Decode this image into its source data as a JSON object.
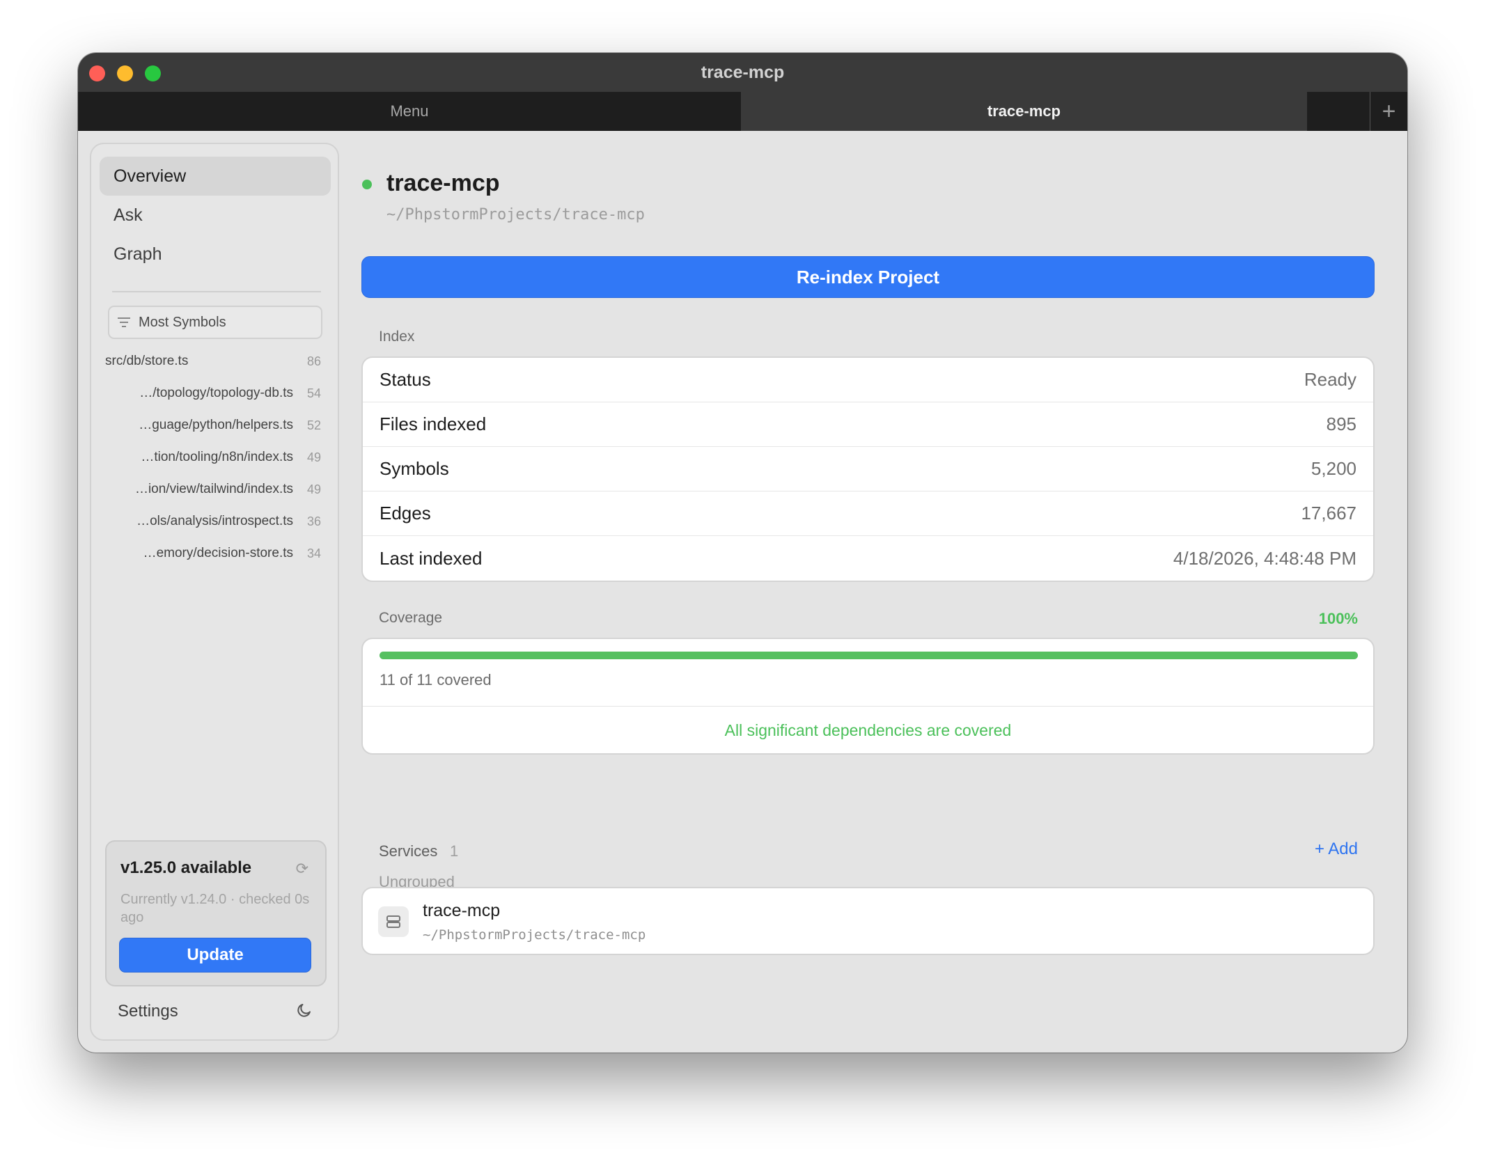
{
  "window": {
    "title": "trace-mcp"
  },
  "tabs": {
    "menu_label": "Menu",
    "active_label": "trace-mcp",
    "add_label": "+"
  },
  "sidebar": {
    "nav": [
      {
        "label": "Overview",
        "active": true
      },
      {
        "label": "Ask",
        "active": false
      },
      {
        "label": "Graph",
        "active": false
      }
    ],
    "filter_label": "Most Symbols",
    "files": [
      {
        "name": "src/db/store.ts",
        "count": "86"
      },
      {
        "name": "…/topology/topology-db.ts",
        "count": "54"
      },
      {
        "name": "…guage/python/helpers.ts",
        "count": "52"
      },
      {
        "name": "…tion/tooling/n8n/index.ts",
        "count": "49"
      },
      {
        "name": "…ion/view/tailwind/index.ts",
        "count": "49"
      },
      {
        "name": "…ols/analysis/introspect.ts",
        "count": "36"
      },
      {
        "name": "…emory/decision-store.ts",
        "count": "34"
      }
    ],
    "update": {
      "title": "v1.25.0 available",
      "subtitle": "Currently v1.24.0 · checked 0s ago",
      "button": "Update"
    },
    "settings_label": "Settings"
  },
  "project": {
    "name": "trace-mcp",
    "path": "~/PhpstormProjects/trace-mcp",
    "status_color": "#4bc05a",
    "reindex_label": "Re-index Project"
  },
  "index": {
    "label": "Index",
    "rows": [
      {
        "key": "Status",
        "value": "Ready"
      },
      {
        "key": "Files indexed",
        "value": "895"
      },
      {
        "key": "Symbols",
        "value": "5,200"
      },
      {
        "key": "Edges",
        "value": "17,667"
      },
      {
        "key": "Last indexed",
        "value": "4/18/2026, 4:48:48 PM"
      }
    ]
  },
  "coverage": {
    "label": "Coverage",
    "percent_label": "100%",
    "fraction": 1.0,
    "count_label": "11 of 11 covered",
    "message": "All significant dependencies are covered"
  },
  "services": {
    "label": "Services",
    "count": "1",
    "add_label": "+ Add",
    "group_label": "Ungrouped",
    "items": [
      {
        "name": "trace-mcp",
        "path": "~/PhpstormProjects/trace-mcp"
      }
    ]
  },
  "colors": {
    "accent": "#3178f6",
    "success": "#4bc05a"
  }
}
